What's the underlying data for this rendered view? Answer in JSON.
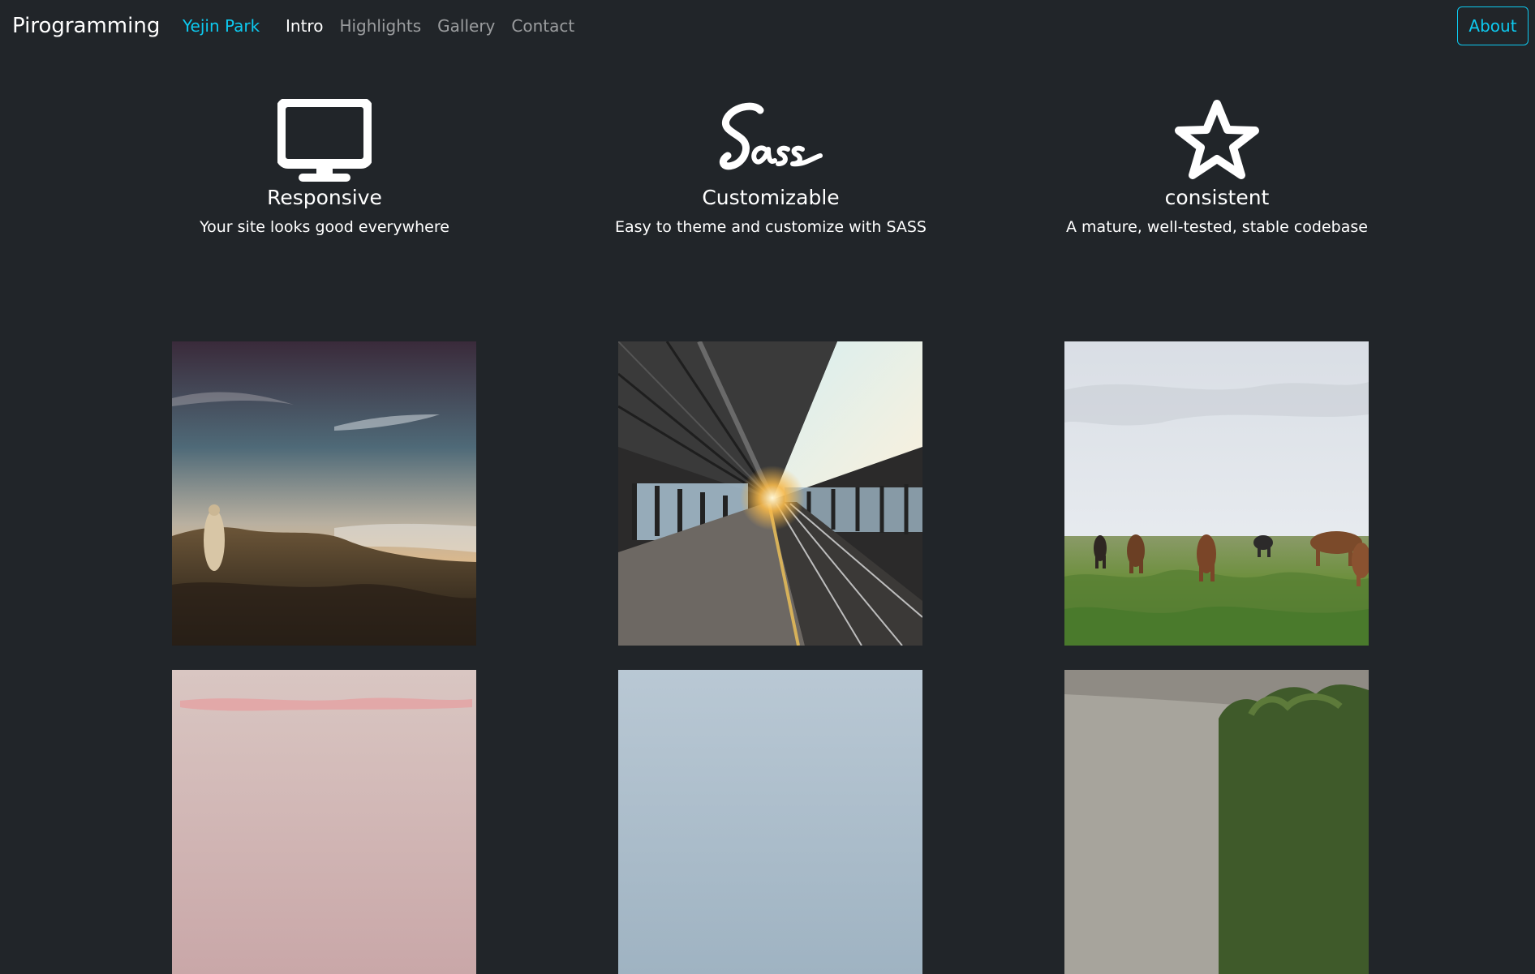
{
  "navbar": {
    "brand": "Pirogramming",
    "author": "Yejin Park",
    "links": [
      {
        "label": "Intro",
        "active": true
      },
      {
        "label": "Highlights",
        "active": false
      },
      {
        "label": "Gallery",
        "active": false
      },
      {
        "label": "Contact",
        "active": false
      }
    ],
    "about_button": "About"
  },
  "features": [
    {
      "icon": "monitor-icon",
      "title": "Responsive",
      "description": "Your site looks good everywhere"
    },
    {
      "icon": "sass-logo-icon",
      "title": "Customizable",
      "description": "Easy to theme and customize with SASS"
    },
    {
      "icon": "star-icon",
      "title": "consistent",
      "description": "A mature, well-tested, stable codebase"
    }
  ],
  "gallery": {
    "images": [
      {
        "subject": "cloaked figure on rocky mountain summit at sunset"
      },
      {
        "subject": "empty train station platform with sunlight"
      },
      {
        "subject": "wild horses grazing on green meadow"
      },
      {
        "subject": "pink sunset sky"
      },
      {
        "subject": "pale blue sky"
      },
      {
        "subject": "trees under cloudy sky"
      }
    ]
  },
  "colors": {
    "background": "#212529",
    "accent": "#0dcaf0",
    "text": "#ffffff",
    "muted_link": "rgba(255,255,255,0.55)"
  }
}
